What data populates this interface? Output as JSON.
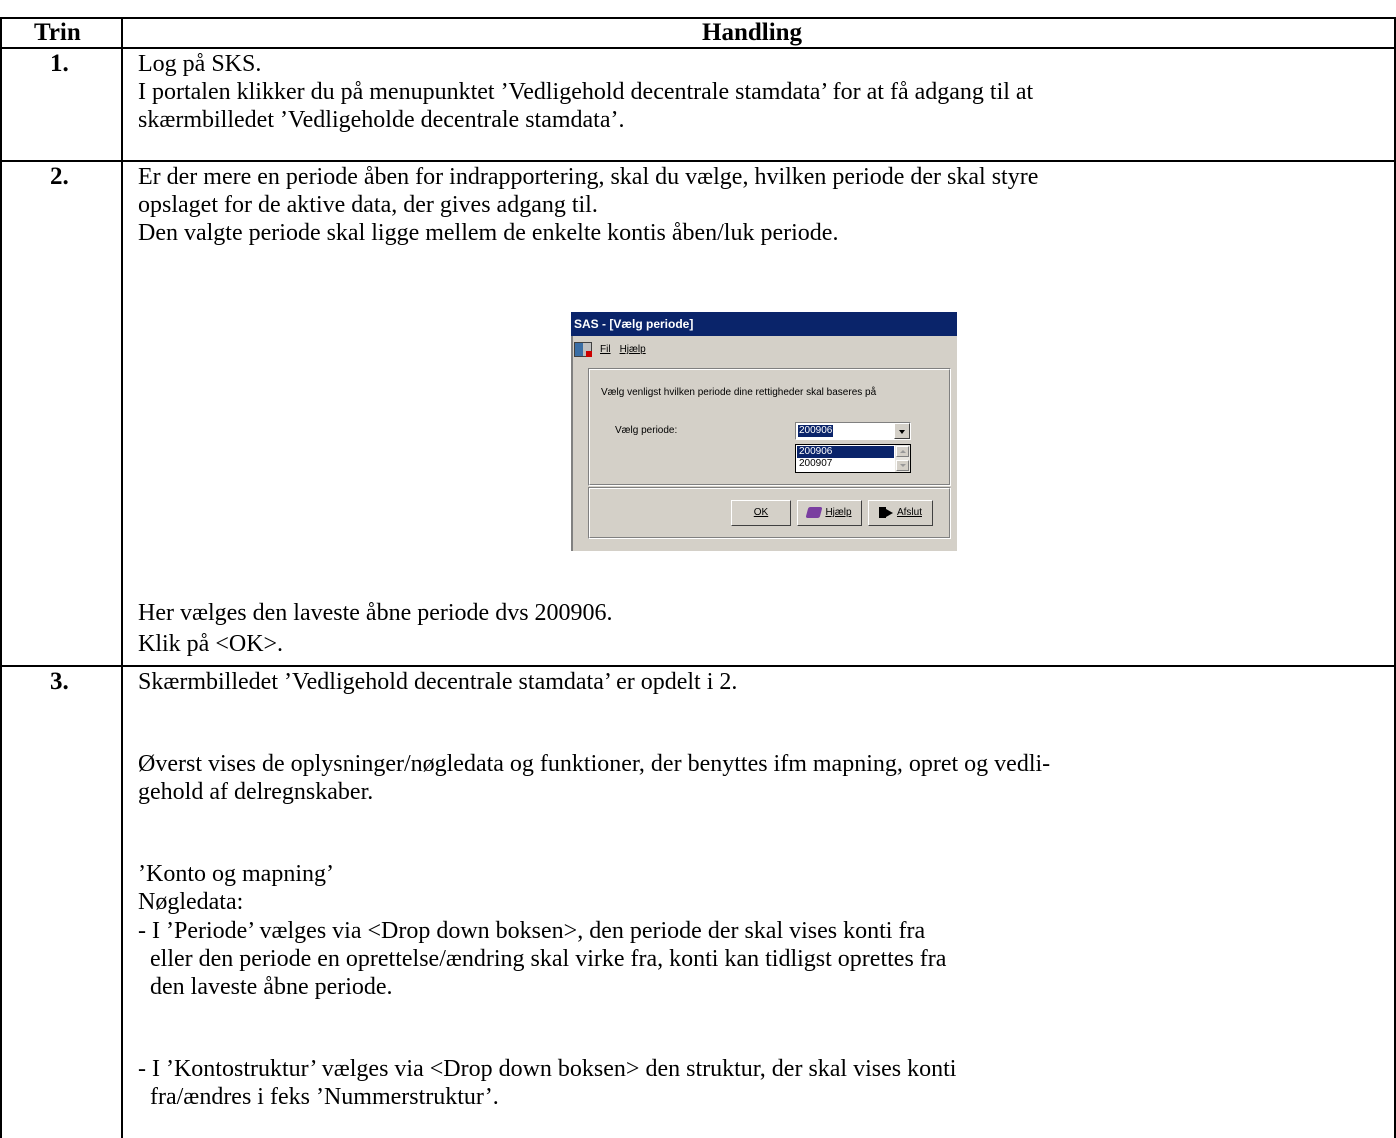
{
  "table": {
    "header": {
      "col1": "Trin",
      "col2": "Handling"
    },
    "rows": [
      {
        "step": "1.",
        "lines": [
          "Log på SKS.",
          "I portalen klikker du på menupunktet ’Vedligehold decentrale stamdata’ for at få adgang til at",
          "skærmbilledet ’Vedligeholde decentrale stamdata’."
        ]
      },
      {
        "step": "2.",
        "lines": [
          "Er der mere en periode åben for indrapportering, skal du vælge, hvilken periode der skal styre",
          "opslaget for de aktive data, der gives adgang til.",
          "Den valgte periode skal ligge mellem de enkelte kontis åben/luk periode."
        ],
        "after_lines": [
          "Her vælges den laveste åbne periode dvs 200906.",
          "Klik på <OK>."
        ]
      },
      {
        "step": "3.",
        "lines": [
          "Skærmbilledet ’Vedligehold decentrale stamdata’ er opdelt i 2.",
          "Øverst vises de oplysninger/nøgledata og funktioner, der benyttes ifm mapning, opret og vedli-",
          "gehold af delregnskaber.",
          "’Konto og mapning’",
          "Nøgledata:",
          "- I ’Periode’ vælges via <Drop down boksen>, den periode der skal vises konti fra",
          "  eller den periode en oprettelse/ændring skal virke fra, konti kan tidligst oprettes fra",
          "  den laveste åbne periode.",
          "- I ’Kontostruktur’ vælges via <Drop down boksen> den struktur, der skal vises konti",
          "  fra/ændres i feks ’Nummerstruktur’."
        ]
      }
    ]
  },
  "dialog": {
    "title": "SAS - [Vælg periode]",
    "menu": [
      "Fil",
      "Hjælp"
    ],
    "prompt": "Vælg venligst hvilken periode dine rettigheder skal baseres på",
    "period_label": "Vælg periode:",
    "selected_period": "200906",
    "options": [
      "200906",
      "200907"
    ],
    "buttons": {
      "ok": "OK",
      "help": "Hjælp",
      "exit": "Afslut"
    },
    "icons": {
      "app": "sas-app-icon",
      "help": "help-book-icon",
      "exit": "exit-door-icon"
    }
  }
}
